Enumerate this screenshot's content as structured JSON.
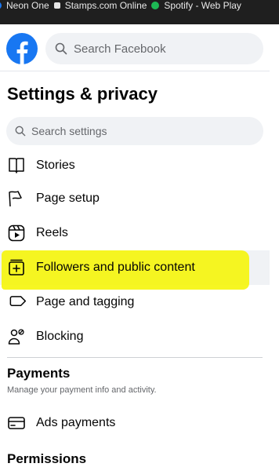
{
  "bookmarks": [
    {
      "label": "Neon One",
      "color": "#1877f2"
    },
    {
      "label": "Stamps.com Online",
      "color": "#2d6cdf"
    },
    {
      "label": "Spotify - Web Play",
      "color": "#1db954"
    }
  ],
  "header": {
    "search_placeholder": "Search Facebook",
    "brand_color": "#1877f2"
  },
  "settings": {
    "title": "Settings & privacy",
    "search_placeholder": "Search settings",
    "items": [
      {
        "label": "Stories",
        "icon": "book-icon"
      },
      {
        "label": "Page setup",
        "icon": "flag-icon"
      },
      {
        "label": "Reels",
        "icon": "reels-icon"
      },
      {
        "label": "Followers and public content",
        "icon": "followers-box-icon"
      },
      {
        "label": "Page and tagging",
        "icon": "tag-icon"
      },
      {
        "label": "Blocking",
        "icon": "blocking-icon"
      }
    ],
    "highlight_color": "#f5f50a"
  },
  "payments": {
    "title": "Payments",
    "subtitle": "Manage your payment info and activity.",
    "items": [
      {
        "label": "Ads payments",
        "icon": "credit-card-icon"
      }
    ]
  },
  "permissions": {
    "title": "Permissions"
  }
}
